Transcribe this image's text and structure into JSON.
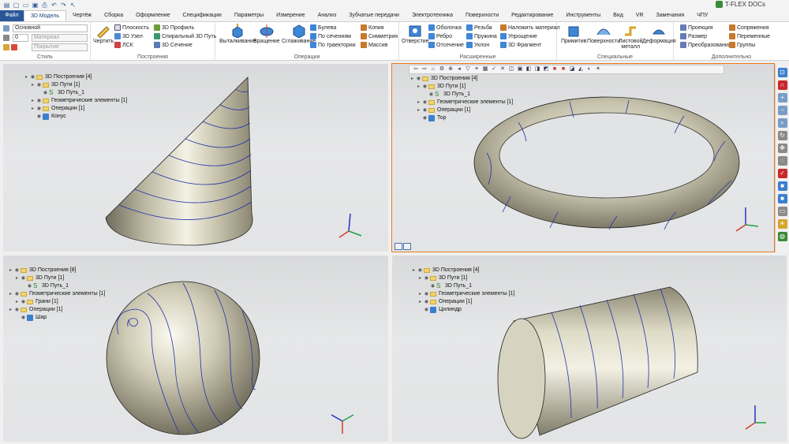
{
  "app": {
    "brand": "T-FLEX DOCs"
  },
  "tabs": [
    "Файл",
    "3D Модель",
    "Чертёж",
    "Сборка",
    "Оформление",
    "Спецификации",
    "Параметры",
    "Измерение",
    "Анализ",
    "Зубчатые передачи",
    "Электротехника",
    "Поверхности",
    "Редактирование",
    "Инструменты",
    "Вид",
    "VR",
    "Замечания",
    "ЧПУ"
  ],
  "ribbon": {
    "style": {
      "layer": "Основной",
      "width": "0",
      "material": "Материал",
      "coating": "Покрытие",
      "title": "Стиль"
    },
    "build": {
      "draw": "Чертить",
      "plane": "Плоскость",
      "node3d": "3D Узел",
      "lsk": "ЛСК",
      "profile": "3D Профиль",
      "spiral": "Спиральный 3D Путь",
      "section": "3D Сечение",
      "title": "Построения"
    },
    "ops": {
      "extrude": "Выталкивание",
      "revolve": "Вращение",
      "smooth": "Сглаживание",
      "bool": "Булева",
      "bysections": "По сечениям",
      "bytraj": "По траектории",
      "copy": "Копия",
      "sym": "Симметрия",
      "array": "Массив",
      "title": "Операции"
    },
    "ext": {
      "hole": "Отверстие",
      "shell": "Оболочка",
      "rib": "Ребро",
      "cut": "Отсечение",
      "thread": "Резьба",
      "spring": "Пружина",
      "slope": "Уклон",
      "material": "Наложить материал",
      "simplify": "Упрощение",
      "frag": "3D Фрагмент",
      "title": "Расширенные"
    },
    "spec": {
      "prim": "Примитив",
      "surf": "Поверхности",
      "sheet1": "Листовой",
      "sheet2": "металл",
      "deform": "Деформация",
      "title": "Специальные"
    },
    "add": {
      "proj": "Проекция",
      "size": "Размер",
      "transform": "Преобразования",
      "conj": "Сопряжения",
      "vars": "Переменные",
      "groups": "Группы",
      "title": "Дополнительно"
    }
  },
  "viewports": {
    "cone": {
      "rows": [
        {
          "t": "3D Построения [4]",
          "kind": "fold",
          "lvl": 0
        },
        {
          "t": "3D Пути [1]",
          "kind": "fold",
          "lvl": 1
        },
        {
          "t": "3D Путь_1",
          "kind": "path",
          "lvl": 2
        },
        {
          "t": "Геометрические элементы [1]",
          "kind": "fold",
          "lvl": 1
        },
        {
          "t": "Операции [1]",
          "kind": "fold",
          "lvl": 1
        },
        {
          "t": "Конус",
          "kind": "cube",
          "lvl": 1
        }
      ]
    },
    "torus": {
      "rows": [
        {
          "t": "3D Построения [4]",
          "kind": "fold",
          "lvl": 0
        },
        {
          "t": "3D Пути [1]",
          "kind": "fold",
          "lvl": 1
        },
        {
          "t": "3D Путь_1",
          "kind": "path",
          "lvl": 2
        },
        {
          "t": "Геометрические элементы [1]",
          "kind": "fold",
          "lvl": 1
        },
        {
          "t": "Операции [1]",
          "kind": "fold",
          "lvl": 1
        },
        {
          "t": "Тор",
          "kind": "cube",
          "lvl": 1
        }
      ]
    },
    "sphere": {
      "rows": [
        {
          "t": "3D Построения [8]",
          "kind": "fold",
          "lvl": 0
        },
        {
          "t": "3D Пути [1]",
          "kind": "fold",
          "lvl": 1
        },
        {
          "t": "3D Путь_1",
          "kind": "path",
          "lvl": 2
        },
        {
          "t": "Геометрические элементы [1]",
          "kind": "fold",
          "lvl": 0
        },
        {
          "t": "Грани [1]",
          "kind": "fold",
          "lvl": 1
        },
        {
          "t": "Операции [1]",
          "kind": "fold",
          "lvl": 0
        },
        {
          "t": "Шар",
          "kind": "cube",
          "lvl": 1
        }
      ]
    },
    "cylinder": {
      "rows": [
        {
          "t": "3D Построения [4]",
          "kind": "fold",
          "lvl": 0
        },
        {
          "t": "3D Пути [1]",
          "kind": "fold",
          "lvl": 1
        },
        {
          "t": "3D Путь_1",
          "kind": "path",
          "lvl": 2
        },
        {
          "t": "Геометрические элементы [1]",
          "kind": "fold",
          "lvl": 1
        },
        {
          "t": "Операции [1]",
          "kind": "fold",
          "lvl": 1
        },
        {
          "t": "Цилиндр",
          "kind": "cube",
          "lvl": 1
        }
      ]
    }
  },
  "triad": {
    "x": "X",
    "y": "Y",
    "z": "Z"
  },
  "colors": {
    "accent": "#2b579a",
    "active_border": "#e87a22",
    "path_line": "#2233aa",
    "model": "#c9c6b2"
  }
}
